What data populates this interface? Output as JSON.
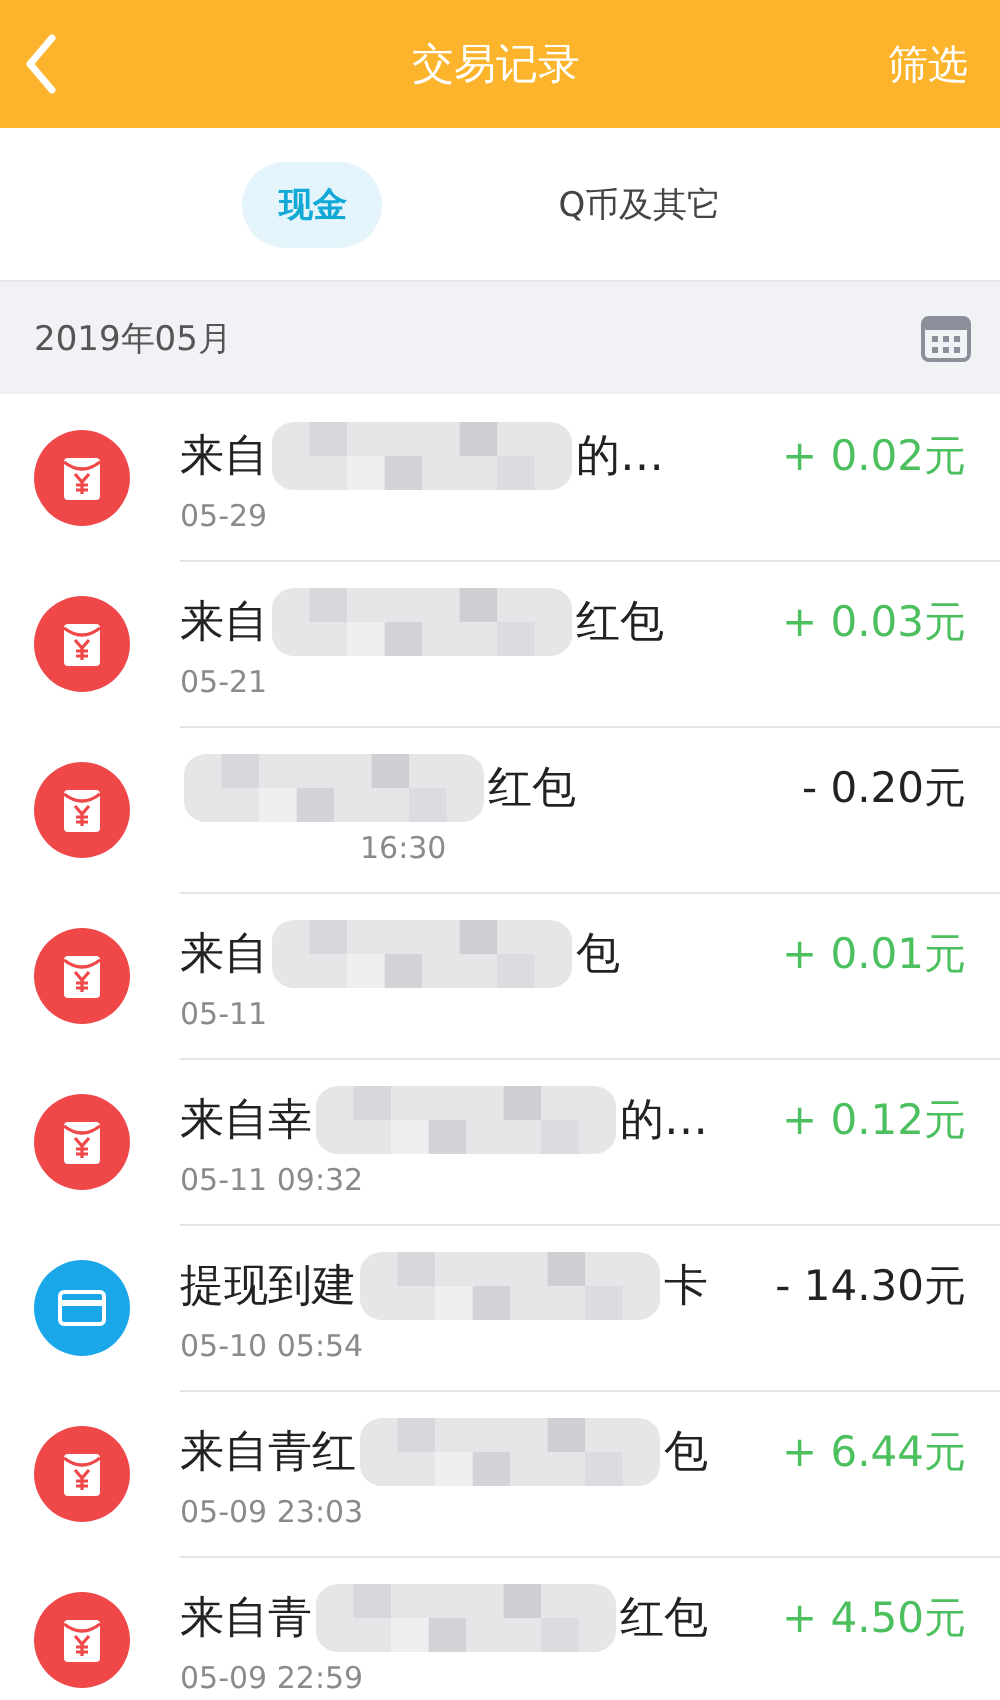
{
  "header": {
    "title": "交易记录",
    "action": "筛选"
  },
  "tabs": [
    {
      "label": "现金",
      "selected": true
    },
    {
      "label": "Q币及其它",
      "selected": false
    }
  ],
  "month": "2019年05月",
  "rows": [
    {
      "kind": "red_packet",
      "title_start": "来自",
      "title_end": "的…",
      "time": "05-29",
      "amount": "+ 0.02元",
      "income": true
    },
    {
      "kind": "red_packet",
      "title_start": "来自",
      "title_end": "红包",
      "time": "05-21",
      "amount": "+ 0.03元",
      "income": true
    },
    {
      "kind": "red_packet",
      "title_start": "",
      "title_end": "红包",
      "time": "16:30",
      "amount": "- 0.20元",
      "income": false
    },
    {
      "kind": "red_packet",
      "title_start": "来自",
      "title_end": "包",
      "time": "05-11",
      "amount": "+ 0.01元",
      "income": true
    },
    {
      "kind": "red_packet",
      "title_start": "来自幸",
      "title_end": "的…",
      "time": "05-11 09:32",
      "amount": "+ 0.12元",
      "income": true
    },
    {
      "kind": "withdrawal",
      "title_start": "提现到建",
      "title_end": "卡",
      "time": "05-10 05:54",
      "amount": "- 14.30元",
      "income": false
    },
    {
      "kind": "red_packet",
      "title_start": "来自青红",
      "title_end": "包",
      "time": "05-09 23:03",
      "amount": "+ 6.44元",
      "income": true
    },
    {
      "kind": "red_packet",
      "title_start": "来自青",
      "title_end": "红包",
      "time": "05-09 22:59",
      "amount": "+ 4.50元",
      "income": true
    }
  ]
}
